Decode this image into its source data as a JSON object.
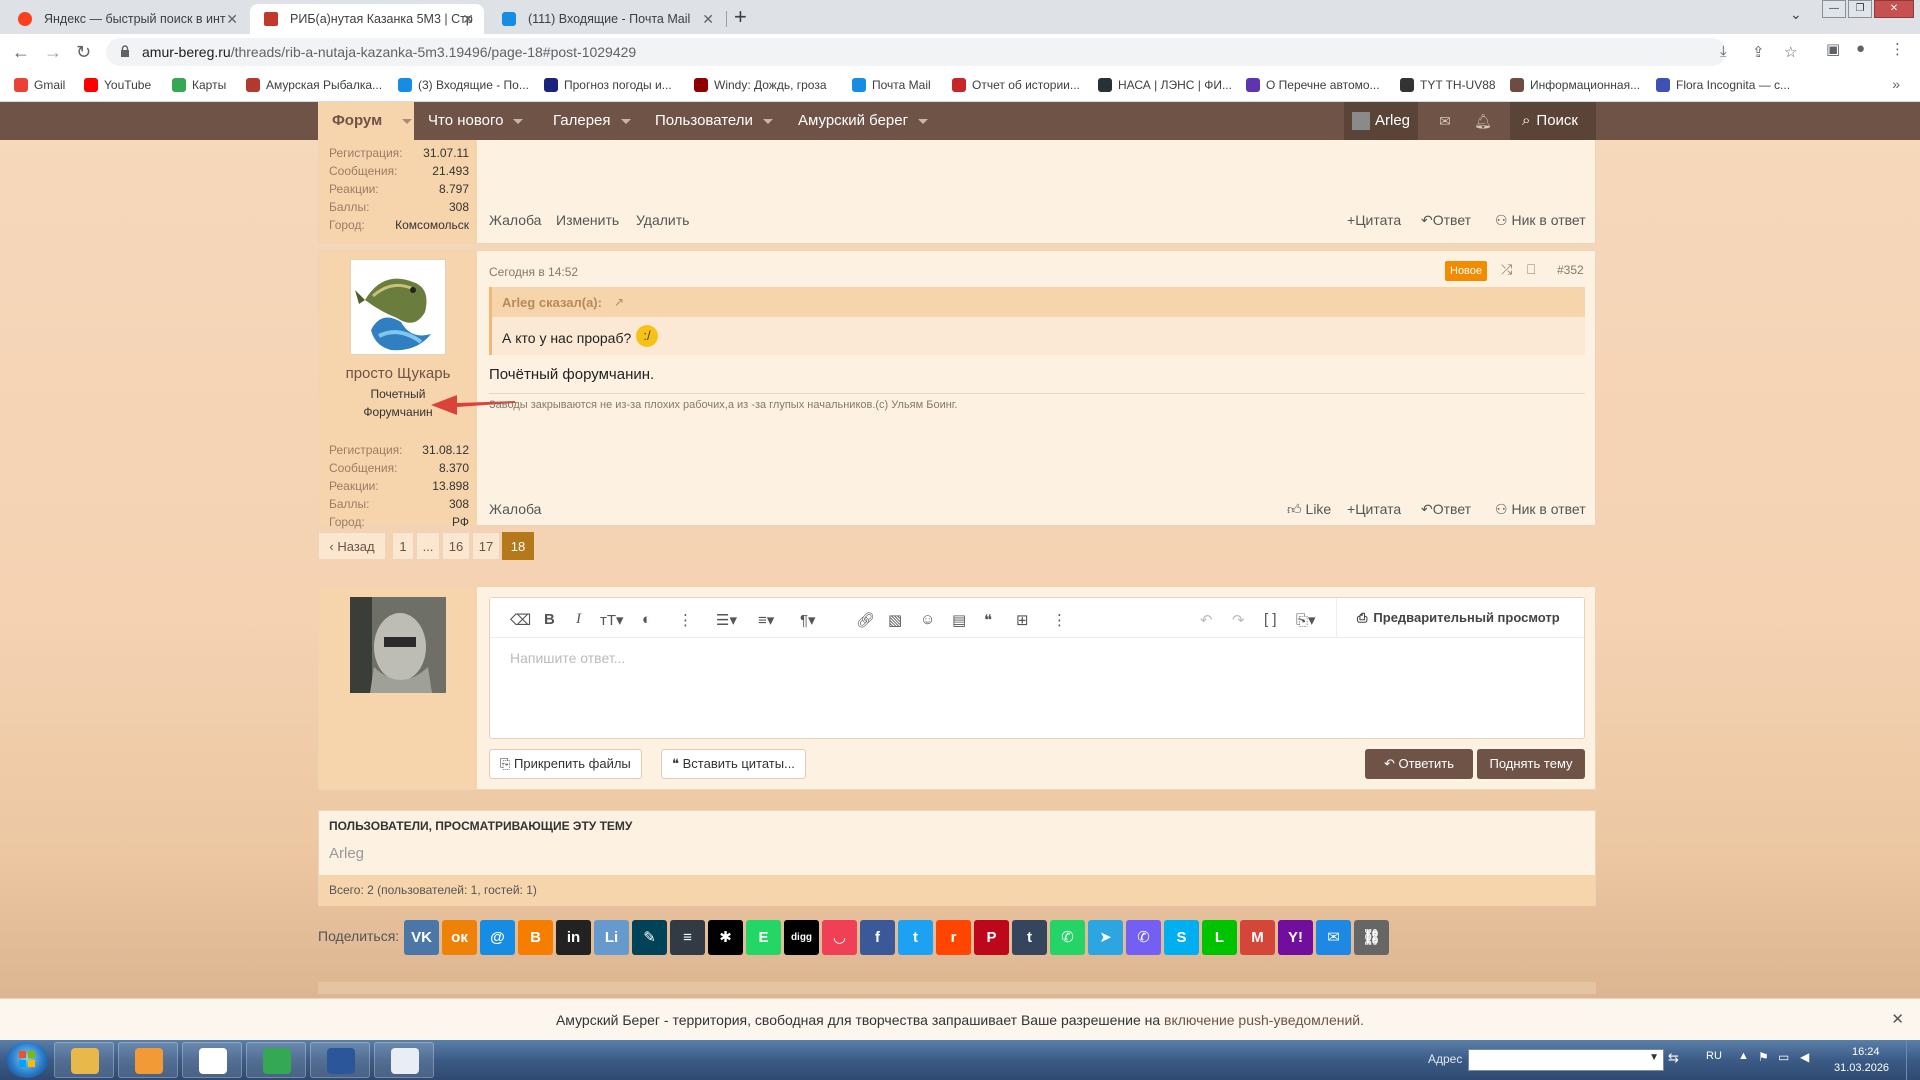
{
  "browser": {
    "tabs": [
      {
        "title": "Яндекс — быстрый поиск в инт",
        "color": "#fc3f1d"
      },
      {
        "title": "РИБ(а)нутая Казанка 5М3 | Стр",
        "color": "#c0392b"
      },
      {
        "title": "(111) Входящие - Почта Mail",
        "color": "#168de2"
      }
    ],
    "url_domain": "amur-bereg.ru",
    "url_path": "/threads/rib-a-nutaja-kazanka-5m3.19496/page-18#post-1029429",
    "bookmarks": [
      "Gmail",
      "YouTube",
      "Карты",
      "Амурская Рыбалка...",
      "(3) Входящие - По...",
      "Прогноз погоды и...",
      "Windy: Дождь, гроза",
      "Почта Mail",
      "Отчет об истории...",
      "НАСА | ЛЭНС | ФИ...",
      "О Перечне автомо...",
      "TYT TH-UV88",
      "Информационная...",
      "Flora Incognita — с..."
    ],
    "bookmark_colors": [
      "#ea4335",
      "#ff0000",
      "#34a853",
      "#b03a2e",
      "#168de2",
      "#1a237e",
      "#8e0000",
      "#168de2",
      "#c62828",
      "#263238",
      "#5e35b1",
      "#333333",
      "#6d4c41",
      "#3f51b5"
    ]
  },
  "nav": {
    "forum": "Форум",
    "items": [
      "Что нового",
      "Галерея",
      "Пользователи",
      "Амурский берег"
    ],
    "user": "Arleg",
    "search": "Поиск"
  },
  "prev_post": {
    "stats": [
      {
        "label": "Регистрация:",
        "value": "31.07.11"
      },
      {
        "label": "Сообщения:",
        "value": "21.493"
      },
      {
        "label": "Реакции:",
        "value": "8.797"
      },
      {
        "label": "Баллы:",
        "value": "308"
      },
      {
        "label": "Город:",
        "value": "Комсомольск"
      }
    ],
    "actions_left": [
      "Жалоба",
      "Изменить",
      "Удалить"
    ],
    "actions_right": [
      "Цитата",
      "Ответ",
      "Ник в ответ"
    ]
  },
  "post": {
    "username": "просто Щукарь",
    "user_title": "Почетный Форумчанин",
    "stats": [
      {
        "label": "Регистрация:",
        "value": "31.08.12"
      },
      {
        "label": "Сообщения:",
        "value": "8.370"
      },
      {
        "label": "Реакции:",
        "value": "13.898"
      },
      {
        "label": "Баллы:",
        "value": "308"
      },
      {
        "label": "Город:",
        "value": "РФ"
      }
    ],
    "date": "Сегодня в 14:52",
    "new_badge": "Новое",
    "number": "#352",
    "quote_author": "Arleg сказал(а):",
    "quote_text": "А кто у нас прораб?",
    "body": "Почётный форумчанин.",
    "signature": "Заводы закрываются не из-за плохих рабочих,а из -за глупых начальников.(с) Ульям Боинг.",
    "action_left": "Жалоба",
    "actions_right": [
      "Like",
      "Цитата",
      "Ответ",
      "Ник в ответ"
    ]
  },
  "pagination": {
    "prev": "Назад",
    "pages": [
      "1",
      "...",
      "16",
      "17",
      "18"
    ],
    "current": "18"
  },
  "editor": {
    "placeholder": "Напишите ответ...",
    "preview": "Предварительный просмотр",
    "attach": "Прикрепить файлы",
    "insert_quotes": "Вставить цитаты...",
    "reply": "Ответить",
    "bump": "Поднять тему"
  },
  "viewers": {
    "title": "ПОЛЬЗОВАТЕЛИ, ПРОСМАТРИВАЮЩИЕ ЭТУ ТЕМУ",
    "user": "Arleg",
    "total": "Всего: 2 (пользователей: 1, гостей: 1)"
  },
  "share": {
    "label": "Поделиться:",
    "buttons": [
      {
        "icon": "vk-icon",
        "glyph": "VK",
        "color": "#4a76a8"
      },
      {
        "icon": "odnoklassniki-icon",
        "glyph": "ок",
        "color": "#ee8208"
      },
      {
        "icon": "mailru-icon",
        "glyph": "@",
        "color": "#168de2"
      },
      {
        "icon": "blogger-icon",
        "glyph": "B",
        "color": "#f57d00"
      },
      {
        "icon": "linkedin-icon",
        "glyph": "in",
        "color": "#222222"
      },
      {
        "icon": "livejournal-icon",
        "glyph": "Li",
        "color": "#6699cc"
      },
      {
        "icon": "livejournal-pen-icon",
        "glyph": "✎",
        "color": "#004359"
      },
      {
        "icon": "buffer-icon",
        "glyph": "≡",
        "color": "#323b43"
      },
      {
        "icon": "asterisk-icon",
        "glyph": "✱",
        "color": "#000000"
      },
      {
        "icon": "evernote-icon",
        "glyph": "E",
        "color": "#24d666"
      },
      {
        "icon": "digg-icon",
        "glyph": "digg",
        "color": "#000000"
      },
      {
        "icon": "pocket-icon",
        "glyph": "◡",
        "color": "#ef4056"
      },
      {
        "icon": "facebook-icon",
        "glyph": "f",
        "color": "#3b5998"
      },
      {
        "icon": "twitter-icon",
        "glyph": "t",
        "color": "#1da1f2"
      },
      {
        "icon": "reddit-icon",
        "glyph": "r",
        "color": "#ff4500"
      },
      {
        "icon": "pinterest-icon",
        "glyph": "P",
        "color": "#bd081c"
      },
      {
        "icon": "tumblr-icon",
        "glyph": "t",
        "color": "#35465c"
      },
      {
        "icon": "whatsapp-icon",
        "glyph": "✆",
        "color": "#25d366"
      },
      {
        "icon": "telegram-icon",
        "glyph": "➤",
        "color": "#2ca5e0"
      },
      {
        "icon": "viber-icon",
        "glyph": "✆",
        "color": "#7360f2"
      },
      {
        "icon": "skype-icon",
        "glyph": "S",
        "color": "#00aff0"
      },
      {
        "icon": "line-icon",
        "glyph": "L",
        "color": "#00c300"
      },
      {
        "icon": "gmail-icon",
        "glyph": "M",
        "color": "#d44638"
      },
      {
        "icon": "yahoo-icon",
        "glyph": "Y!",
        "color": "#720e9e"
      },
      {
        "icon": "email-icon",
        "glyph": "✉",
        "color": "#1e88e5"
      },
      {
        "icon": "copy-link-icon",
        "glyph": "⛓",
        "color": "#666666"
      }
    ]
  },
  "push_notice": {
    "text": "Амурский Берег - территория, свободная для творчества запрашивает Ваше разрешение на ",
    "link": "включение push-уведомлений."
  },
  "taskbar": {
    "address_label": "Адрес",
    "lang": "RU",
    "time": "16:24",
    "date": "31.03.2026",
    "apps": [
      {
        "icon": "explorer-icon",
        "color": "#e8b84a"
      },
      {
        "icon": "media-player-icon",
        "color": "#f29b36"
      },
      {
        "icon": "yandex-browser-icon",
        "color": "#ffffff"
      },
      {
        "icon": "chrome-icon",
        "color": "#34a853"
      },
      {
        "icon": "word-icon",
        "color": "#2b579a"
      },
      {
        "icon": "calculator-icon",
        "color": "#e9eef4"
      }
    ]
  },
  "colors": {
    "nav": "#6e5346",
    "accent": "#f7d5ac",
    "badge": "#f28b00",
    "button": "#6e5346",
    "current_page": "#b5781a"
  }
}
